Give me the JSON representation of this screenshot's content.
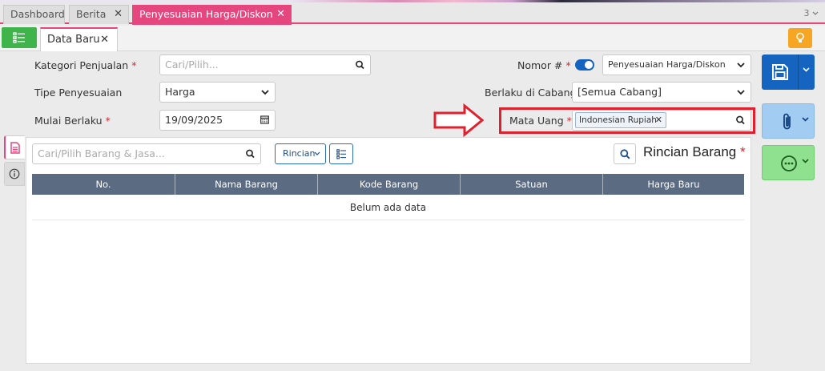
{
  "tabs": [
    {
      "label": "Dashboard",
      "closable": false
    },
    {
      "label": "Berita",
      "closable": true
    },
    {
      "label": "Penyesuaian Harga/Diskon",
      "closable": true,
      "active": true
    }
  ],
  "tab_count": "3",
  "subtab": {
    "label": "Data Baru"
  },
  "form": {
    "kategori_label": "Kategori Penjualan",
    "kategori_placeholder": "Cari/Pilih...",
    "tipe_label": "Tipe Penyesuaian",
    "tipe_value": "Harga",
    "mulai_label": "Mulai Berlaku",
    "mulai_value": "19/09/2025",
    "nomor_label": "Nomor #",
    "nomor_value": "Penyesuaian Harga/Diskon",
    "cabang_label": "Berlaku di Cabang",
    "cabang_value": "[Semua Cabang]",
    "mata_uang_label": "Mata Uang",
    "mata_uang_value": "Indonesian Rupiah",
    "required_mark": "*"
  },
  "detail": {
    "search_placeholder": "Cari/Pilih Barang & Jasa...",
    "rincian_button": "Rincian",
    "title": "Rincian Barang",
    "columns": [
      "No.",
      "Nama Barang",
      "Kode Barang",
      "Satuan",
      "Harga Baru"
    ],
    "empty_text": "Belum ada data"
  },
  "colors": {
    "accent": "#e4467d",
    "primary": "#1565c0",
    "success": "#3fb44a",
    "warning": "#f6a623",
    "table_header": "#5a6b82",
    "highlight": "#e0202c"
  }
}
